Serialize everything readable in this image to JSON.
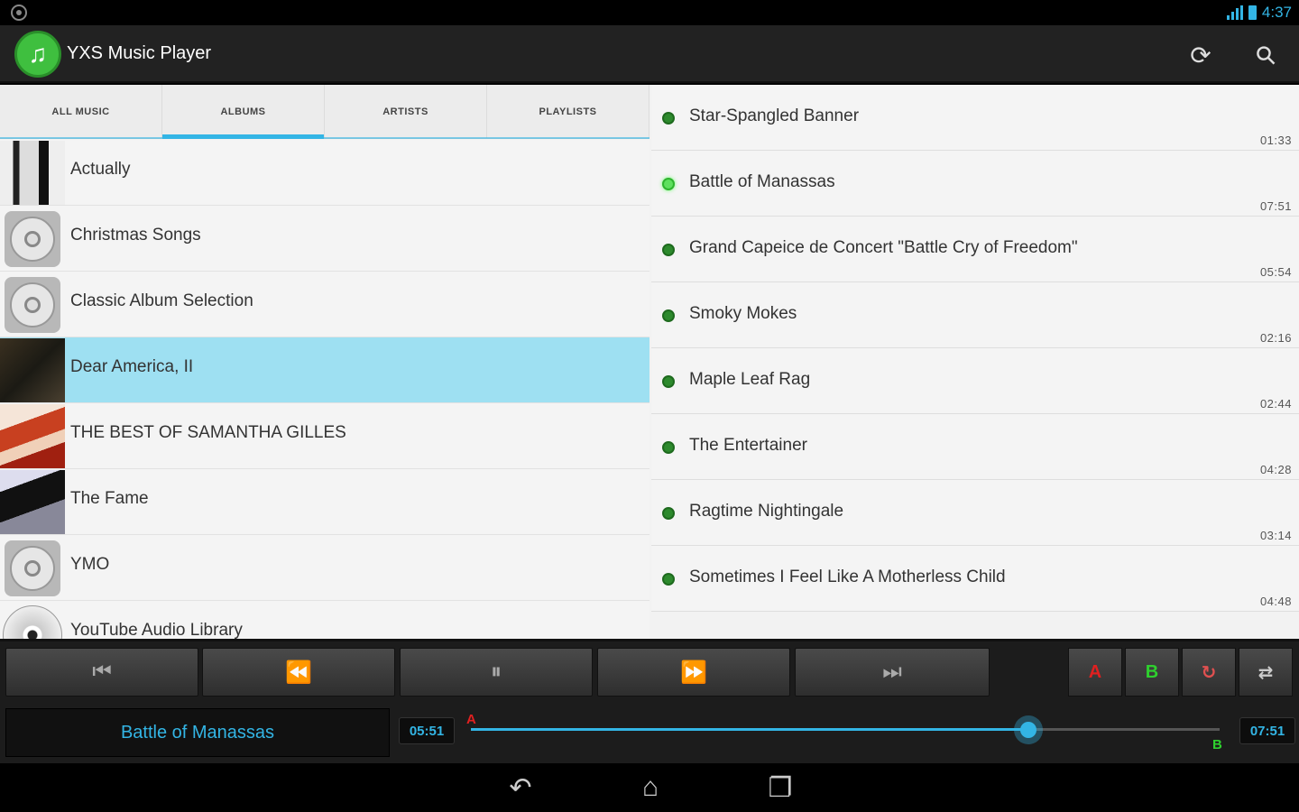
{
  "status": {
    "time": "4:37"
  },
  "app": {
    "title": "YXS Music Player",
    "colors": {
      "accent": "#33b5e5",
      "logo": "#3fbf3f"
    }
  },
  "actions": {
    "refresh_icon": "refresh-icon",
    "settings_icon": "wrench-icon"
  },
  "tabs": [
    {
      "label": "ALL MUSIC",
      "active": false
    },
    {
      "label": "ALBUMS",
      "active": true
    },
    {
      "label": "ARTISTS",
      "active": false
    },
    {
      "label": "PLAYLISTS",
      "active": false
    }
  ],
  "albums": [
    {
      "title": "Actually",
      "art": "photo"
    },
    {
      "title": "Christmas Songs",
      "art": "disc"
    },
    {
      "title": "Classic Album Selection",
      "art": "disc"
    },
    {
      "title": "Dear America, II",
      "art": "photo",
      "selected": true
    },
    {
      "title": "THE BEST OF SAMANTHA GILLES",
      "art": "photo"
    },
    {
      "title": "The Fame",
      "art": "photo"
    },
    {
      "title": "YMO",
      "art": "disc"
    },
    {
      "title": "YouTube Audio Library",
      "art": "cd"
    }
  ],
  "tracks": [
    {
      "title": "Star-Spangled Banner",
      "duration": "01:33"
    },
    {
      "title": "Battle of Manassas",
      "duration": "07:51",
      "playing": true
    },
    {
      "title": "Grand Capeice de Concert \"Battle Cry of Freedom\"",
      "duration": "05:54"
    },
    {
      "title": "Smoky Mokes",
      "duration": "02:16"
    },
    {
      "title": "Maple Leaf Rag",
      "duration": "02:44"
    },
    {
      "title": "The Entertainer",
      "duration": "04:28"
    },
    {
      "title": "Ragtime Nightingale",
      "duration": "03:14"
    },
    {
      "title": "Sometimes I Feel Like A Motherless Child",
      "duration": "04:48"
    }
  ],
  "player": {
    "now_playing": "Battle of Manassas",
    "elapsed": "05:51",
    "total": "07:51",
    "progress": 0.745,
    "a_label": "A",
    "b_label": "B",
    "a_color": "#e02020",
    "b_color": "#2ed02e",
    "buttons": {
      "prev": "skip-previous-icon",
      "rewind": "rewind-icon",
      "pause": "pause-icon",
      "forward": "fast-forward-icon",
      "next": "skip-next-icon",
      "repeat": "repeat-icon",
      "shuffle": "shuffle-icon"
    }
  }
}
